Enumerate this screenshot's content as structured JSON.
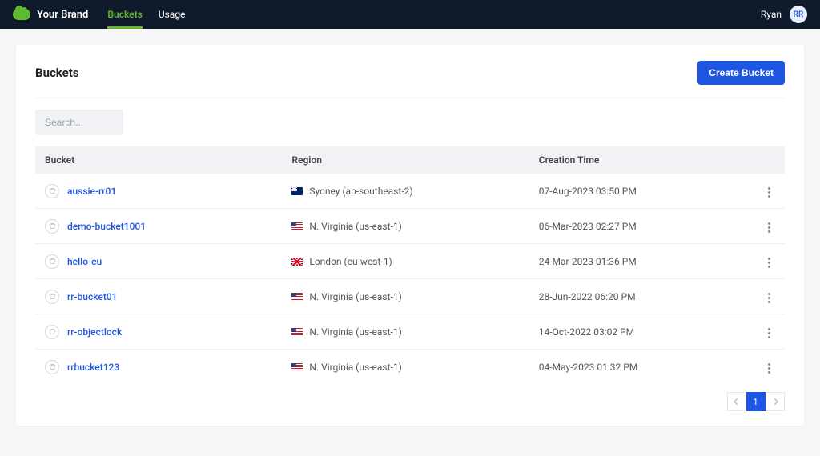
{
  "header": {
    "brand": "Your Brand",
    "tabs": [
      {
        "label": "Buckets",
        "active": true
      },
      {
        "label": "Usage",
        "active": false
      }
    ],
    "user": {
      "name": "Ryan",
      "initials": "RR"
    }
  },
  "page": {
    "title": "Buckets",
    "create_button": "Create Bucket",
    "search_placeholder": "Search..."
  },
  "columns": {
    "bucket": "Bucket",
    "region": "Region",
    "creation": "Creation Time"
  },
  "rows": [
    {
      "name": "aussie-rr01",
      "flag": "au",
      "region": "Sydney (ap-southeast-2)",
      "created": "07-Aug-2023 03:50 PM"
    },
    {
      "name": "demo-bucket1001",
      "flag": "us",
      "region": "N. Virginia (us-east-1)",
      "created": "06-Mar-2023 02:27 PM"
    },
    {
      "name": "hello-eu",
      "flag": "uk",
      "region": "London (eu-west-1)",
      "created": "24-Mar-2023 01:36 PM"
    },
    {
      "name": "rr-bucket01",
      "flag": "us",
      "region": "N. Virginia (us-east-1)",
      "created": "28-Jun-2022 06:20 PM"
    },
    {
      "name": "rr-objectlock",
      "flag": "us",
      "region": "N. Virginia (us-east-1)",
      "created": "14-Oct-2022 03:02 PM"
    },
    {
      "name": "rrbucket123",
      "flag": "us",
      "region": "N. Virginia (us-east-1)",
      "created": "04-May-2023 01:32 PM"
    }
  ],
  "pagination": {
    "current": "1"
  }
}
